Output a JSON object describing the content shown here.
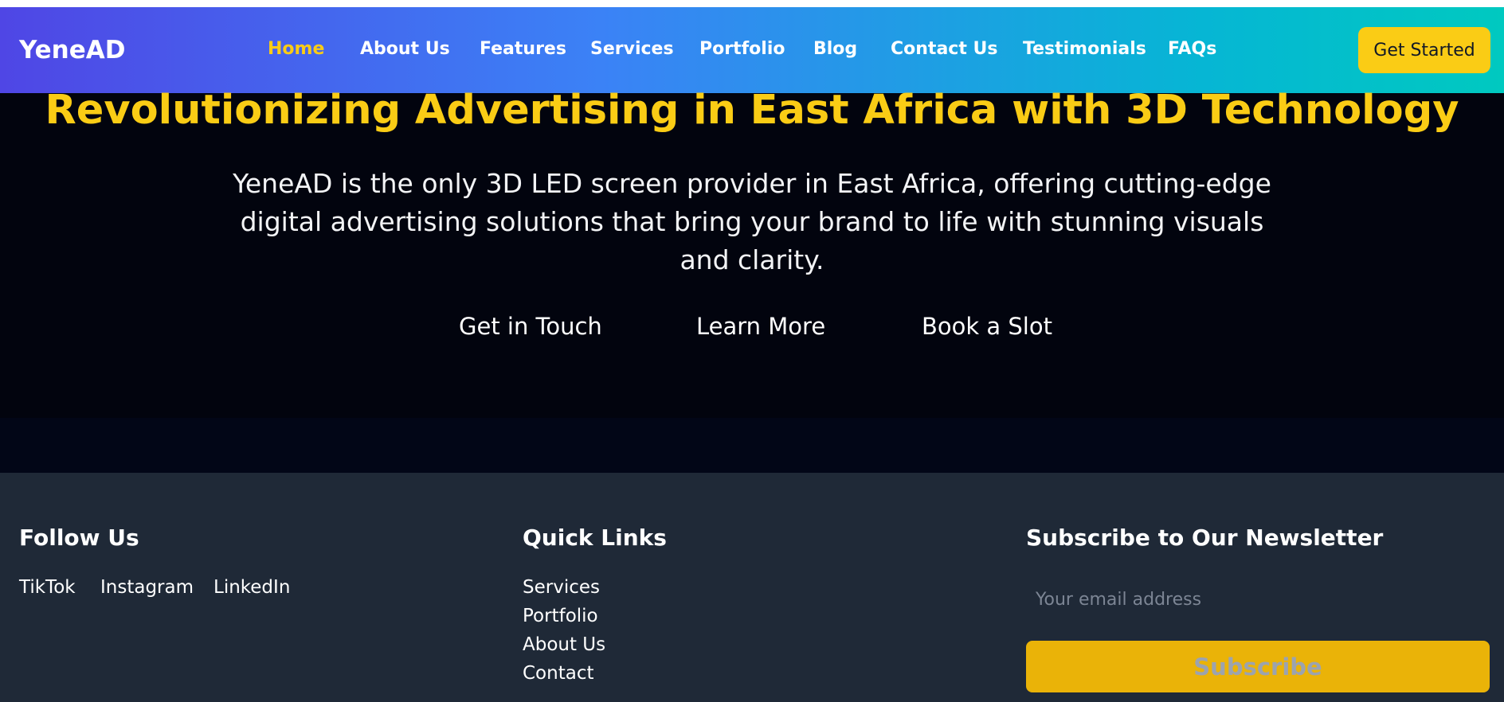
{
  "nav": {
    "logo": "YeneAD",
    "links": [
      "Home",
      "About Us",
      "Features",
      "Services",
      "Portfolio",
      "Blog",
      "Contact Us",
      "Testimonials",
      "FAQs"
    ],
    "active": "Home",
    "cta": "Get Started"
  },
  "hero": {
    "title": "Revolutionizing Advertising in East Africa with 3D Technology",
    "description": "YeneAD is the only 3D LED screen provider in East Africa, offering cutting-edge digital advertising solutions that bring your brand to life with stunning visuals and clarity.",
    "buttons": [
      "Get in Touch",
      "Learn More",
      "Book a Slot"
    ]
  },
  "footer": {
    "follow": {
      "heading": "Follow Us",
      "links": [
        "TikTok",
        "Instagram",
        "LinkedIn"
      ]
    },
    "quick_links": {
      "heading": "Quick Links",
      "links": [
        "Services",
        "Portfolio",
        "About Us",
        "Contact"
      ]
    },
    "newsletter": {
      "heading": "Subscribe to Our Newsletter",
      "placeholder": "Your email address",
      "button": "Subscribe"
    }
  },
  "colors": {
    "accent": "#facc15",
    "hero_bg": "#02040e",
    "footer_bg": "#1f2937",
    "subscribe_bg": "#eab308"
  }
}
